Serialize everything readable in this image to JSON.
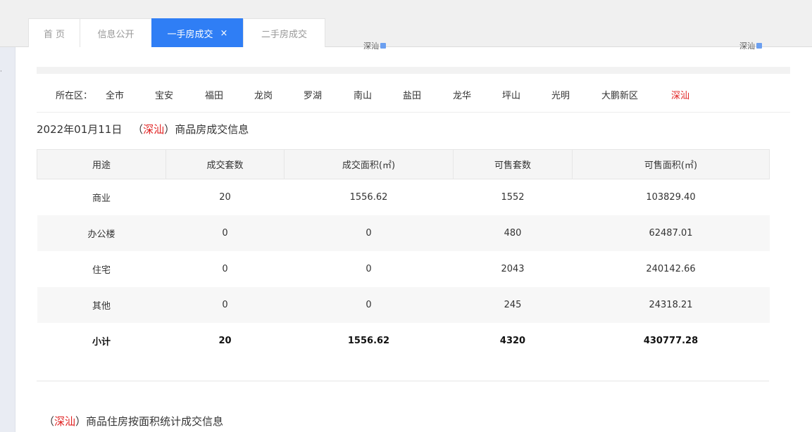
{
  "tabs": [
    {
      "label": "首 页"
    },
    {
      "label": "信息公开"
    },
    {
      "label": "一手房成交",
      "close": "×"
    },
    {
      "label": "二手房成交"
    }
  ],
  "cut_labels": [
    "深汕",
    "深汕"
  ],
  "district_filter": {
    "label": "所在区：",
    "items": [
      "全市",
      "宝安",
      "福田",
      "龙岗",
      "罗湖",
      "南山",
      "盐田",
      "龙华",
      "坪山",
      "光明",
      "大鹏新区",
      "深汕"
    ],
    "selected": "深汕"
  },
  "section1": {
    "date": "2022年01月11日",
    "paren_open": "（",
    "district": "深汕",
    "paren_close": "）",
    "suffix": "商品房成交信息"
  },
  "table": {
    "headers": [
      "用途",
      "成交套数",
      "成交面积(㎡)",
      "可售套数",
      "可售面积(㎡)"
    ],
    "rows": [
      [
        "商业",
        "20",
        "1556.62",
        "1552",
        "103829.40"
      ],
      [
        "办公楼",
        "0",
        "0",
        "480",
        "62487.01"
      ],
      [
        "住宅",
        "0",
        "0",
        "2043",
        "240142.66"
      ],
      [
        "其他",
        "0",
        "0",
        "245",
        "24318.21"
      ]
    ],
    "total": [
      "小计",
      "20",
      "1556.62",
      "4320",
      "430777.28"
    ]
  },
  "section2": {
    "paren_open": "（",
    "district": "深汕",
    "paren_close": "）",
    "suffix": "商品住房按面积统计成交信息"
  },
  "colors": {
    "accent": "#2f7ef5",
    "highlight": "#e02020"
  }
}
